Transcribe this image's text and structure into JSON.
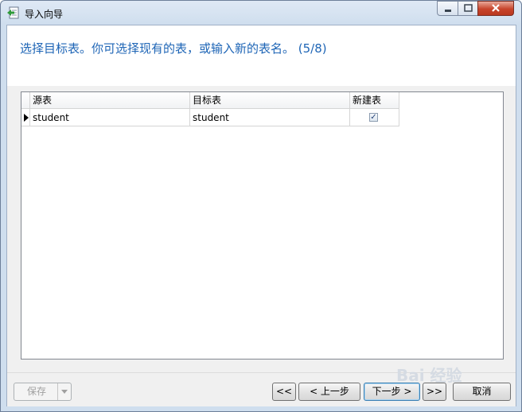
{
  "window": {
    "title": "导入向导",
    "controls": {
      "minimize": "–",
      "maximize": "□",
      "close": "✕"
    }
  },
  "header": {
    "instruction": "选择目标表。你可选择现有的表，或输入新的表名。 (5/8)"
  },
  "grid": {
    "columns": [
      "源表",
      "目标表",
      "新建表"
    ],
    "rows": [
      {
        "source": "student",
        "target": "student",
        "new_table": true
      }
    ],
    "checkmark": "✓"
  },
  "footer": {
    "save_label": "保存",
    "first_label": "<<",
    "prev_label": "< 上一步",
    "next_label": "下一步 >",
    "last_label": ">>",
    "cancel_label": "取消"
  },
  "watermark": "Bai 经验"
}
